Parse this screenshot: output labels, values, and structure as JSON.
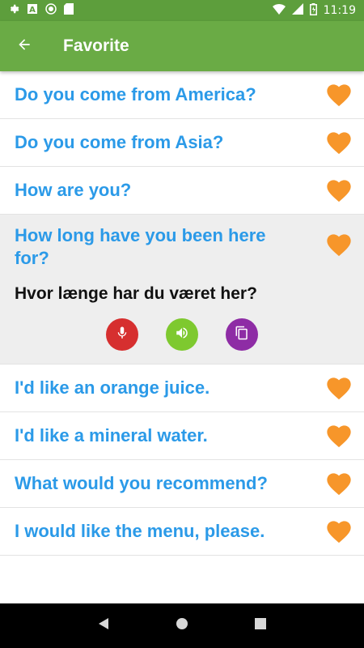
{
  "status_bar": {
    "time": "11:19",
    "icons": [
      "gear-icon",
      "a-icon",
      "circle-icon",
      "sd-card-icon",
      "wifi-icon",
      "signal-icon",
      "battery-icon"
    ]
  },
  "app_bar": {
    "title": "Favorite",
    "back_icon": "arrow-left-icon"
  },
  "colors": {
    "status_bar": "#5d9e3c",
    "app_bar": "#6aab45",
    "phrase_text": "#2b9ae8",
    "heart": "#f7962a",
    "mic_button": "#d62f2f",
    "speaker_button": "#7ec92f",
    "copy_button": "#8e2ca5"
  },
  "favorites": [
    {
      "phrase": "Do you come from America?"
    },
    {
      "phrase": "Do you come from Asia?"
    },
    {
      "phrase": "How are you?"
    },
    {
      "phrase": "How long have you been here for?",
      "translation": "Hvor længe har du været her?",
      "expanded": true
    },
    {
      "phrase": "I'd like an orange juice."
    },
    {
      "phrase": "I'd like a mineral water."
    },
    {
      "phrase": "What would you recommend?"
    },
    {
      "phrase": "I would like the menu, please."
    }
  ],
  "expanded_actions": [
    "microphone-icon",
    "speaker-icon",
    "copy-icon"
  ],
  "nav_bar": [
    "back-triangle-icon",
    "home-circle-icon",
    "recents-square-icon"
  ]
}
